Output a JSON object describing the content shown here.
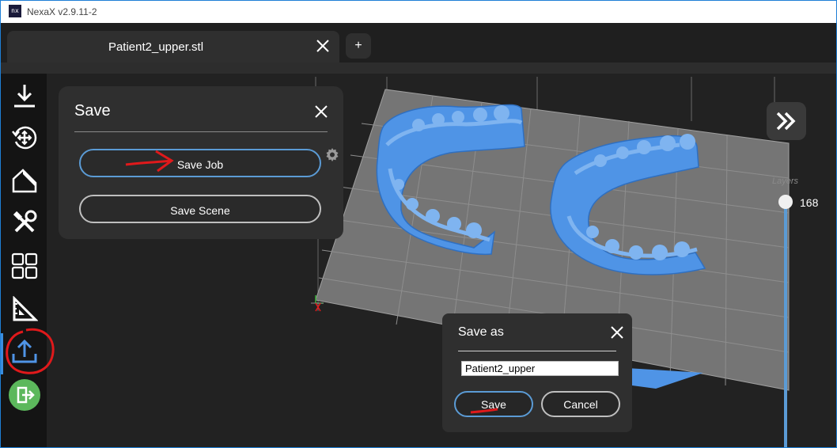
{
  "window": {
    "title": "NexaX v2.9.11-2",
    "icon_label": "nx"
  },
  "tabs": [
    {
      "label": "Patient2_upper.stl"
    }
  ],
  "tab_add_label": "+",
  "sidebar": {
    "items": [
      {
        "name": "download-icon"
      },
      {
        "name": "move-rotate-icon"
      },
      {
        "name": "eraser-icon"
      },
      {
        "name": "tools-icon"
      },
      {
        "name": "grid-icon"
      },
      {
        "name": "ruler-triangle-icon"
      },
      {
        "name": "export-upload-icon"
      },
      {
        "name": "exit-icon"
      }
    ]
  },
  "save_panel": {
    "title": "Save",
    "save_job_label": "Save Job",
    "save_scene_label": "Save Scene"
  },
  "layers": {
    "label": "Layers",
    "value": "168"
  },
  "save_as_dialog": {
    "title": "Save as",
    "filename": "Patient2_upper",
    "save_label": "Save",
    "cancel_label": "Cancel"
  },
  "colors": {
    "accent": "#5b9bd5",
    "model": "#4f94e6",
    "panel": "#2f2f2f",
    "annotation": "#e0191b",
    "exit_button": "#5cb85c"
  }
}
